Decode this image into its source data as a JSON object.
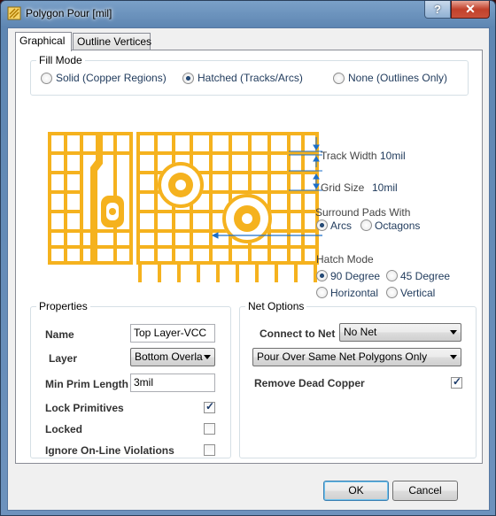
{
  "window": {
    "title": "Polygon Pour [mil]",
    "help_label": "?",
    "close_label": "✕"
  },
  "tabs": [
    {
      "label": "Graphical",
      "active": true
    },
    {
      "label": "Outline Vertices",
      "active": false
    }
  ],
  "fill_mode": {
    "title": "Fill Mode",
    "options": [
      {
        "label": "Solid (Copper Regions)",
        "selected": false
      },
      {
        "label": "Hatched (Tracks/Arcs)",
        "selected": true
      },
      {
        "label": "None (Outlines Only)",
        "selected": false
      }
    ]
  },
  "hatch_settings": {
    "track_width_label": "Track Width",
    "track_width_value": "10mil",
    "grid_size_label": "Grid Size",
    "grid_size_value": "10mil",
    "surround_label": "Surround Pads With",
    "surround_options": [
      {
        "label": "Arcs",
        "selected": true
      },
      {
        "label": "Octagons",
        "selected": false
      }
    ],
    "hatch_mode_label": "Hatch Mode",
    "hatch_mode_options": [
      {
        "label": "90 Degree",
        "selected": true
      },
      {
        "label": "45 Degree",
        "selected": false
      },
      {
        "label": "Horizontal",
        "selected": false
      },
      {
        "label": "Vertical",
        "selected": false
      }
    ]
  },
  "properties": {
    "title": "Properties",
    "name_label": "Name",
    "name_value": "Top Layer-VCC",
    "layer_label": "Layer",
    "layer_value": "Bottom Overla",
    "min_prim_label": "Min Prim Length",
    "min_prim_value": "3mil",
    "lock_primitives_label": "Lock Primitives",
    "lock_primitives_checked": true,
    "locked_label": "Locked",
    "locked_checked": false,
    "ignore_label": "Ignore On-Line Violations",
    "ignore_checked": false
  },
  "net_options": {
    "title": "Net Options",
    "connect_label": "Connect to Net",
    "connect_value": "No Net",
    "pour_mode_value": "Pour Over Same Net Polygons Only",
    "remove_dead_label": "Remove Dead Copper",
    "remove_dead_checked": true
  },
  "buttons": {
    "ok": "OK",
    "cancel": "Cancel"
  },
  "colors": {
    "copper": "#f5b21e",
    "accent": "#1e395b",
    "dimension_arrow": "#1c6fc9"
  }
}
